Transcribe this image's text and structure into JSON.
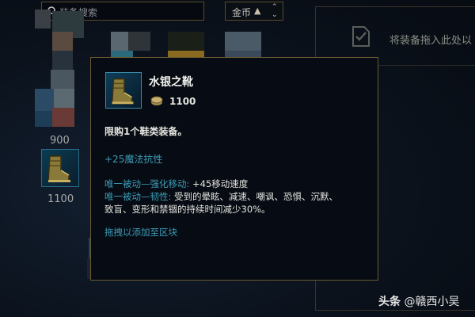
{
  "search": {
    "placeholder": "装备搜索"
  },
  "sort": {
    "label": "金币"
  },
  "drop_zone": {
    "text": "将装备拖入此处以"
  },
  "items": {
    "prices": [
      "900",
      "1100"
    ]
  },
  "tooltip": {
    "name": "水银之靴",
    "cost": "1100",
    "limit": "限购1个鞋类装备。",
    "stat": "+25魔法抗性",
    "passive1_label": "唯一被动—强化移动:",
    "passive1_value": " +45移动速度",
    "passive2_label": "唯一被动—韧性:",
    "passive2_value": " 受到的晕眩、减速、嘲讽、恐惧、沉默、",
    "passive2_cont": "致盲、变形和禁锢的持续时间减少30%。",
    "cta": "拖拽以添加至区块"
  },
  "watermark": {
    "prefix": "头条",
    "handle": " @赣西小吴"
  },
  "colors": {
    "gold_border": "#6b5a32",
    "blue_text": "#3c9bb6",
    "bg": "#0a1018"
  }
}
